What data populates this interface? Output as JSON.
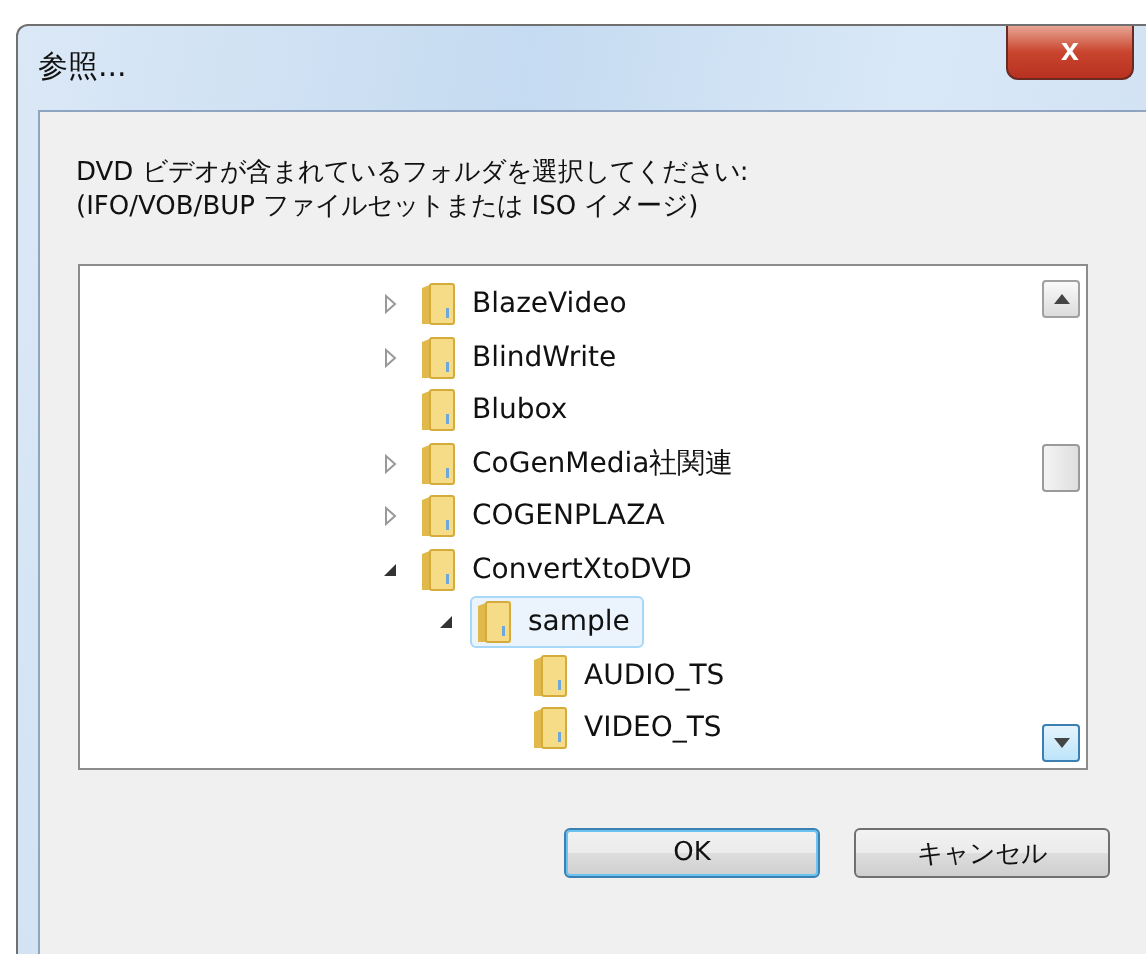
{
  "window": {
    "title": "参照...",
    "close": "x"
  },
  "prompt": [
    "DVD ビデオが含まれているフォルダを選択してください:",
    "(IFO/VOB/BUP ファイルセットまたは ISO イメージ)"
  ],
  "tree": [
    {
      "label": "BlazeVideo",
      "expanded": false,
      "selected": false
    },
    {
      "label": "BlindWrite",
      "expanded": false,
      "selected": false
    },
    {
      "label": "Blubox",
      "selected": false
    },
    {
      "label": "CoGenMedia社関連",
      "expanded": false,
      "selected": false
    },
    {
      "label": "COGENPLAZA",
      "expanded": false,
      "selected": false
    },
    {
      "label": "ConvertXtoDVD",
      "expanded": true,
      "selected": false,
      "children": [
        {
          "label": "sample",
          "expanded": true,
          "selected": true,
          "children": [
            {
              "label": "AUDIO_TS",
              "selected": false
            },
            {
              "label": "VIDEO_TS",
              "selected": false
            }
          ]
        }
      ]
    }
  ],
  "buttons": [
    {
      "label": "OK",
      "default": true
    },
    {
      "label": "キャンセル",
      "default": false
    }
  ]
}
